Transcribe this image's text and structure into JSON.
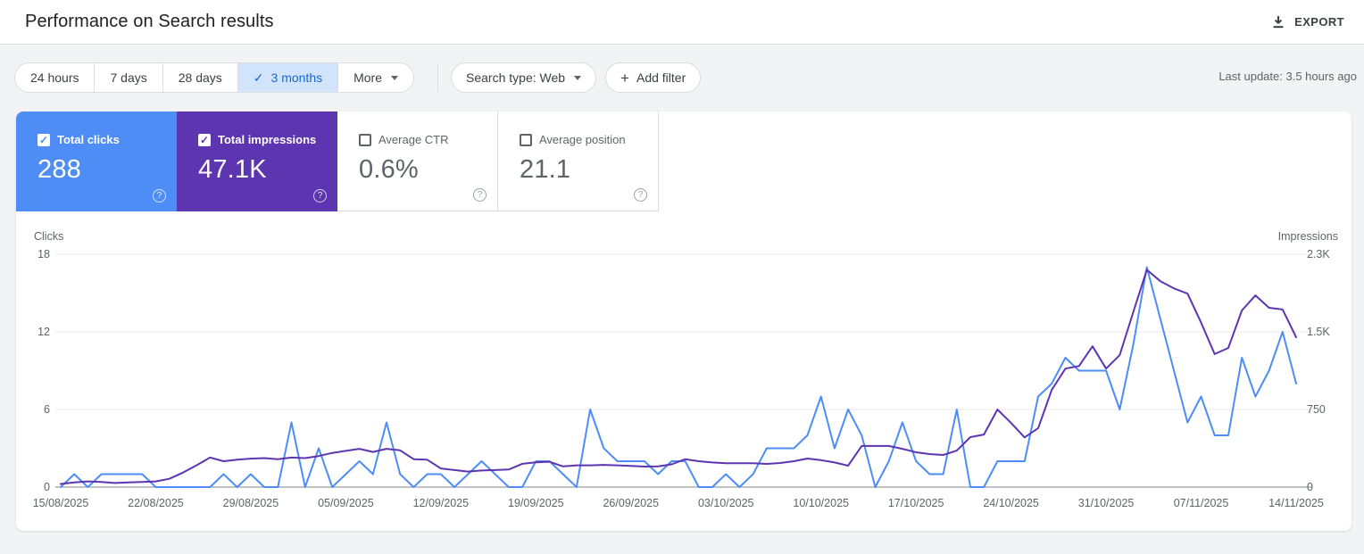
{
  "header": {
    "title": "Performance on Search results",
    "export_label": "EXPORT"
  },
  "filters": {
    "date_ranges": [
      {
        "label": "24 hours",
        "selected": false
      },
      {
        "label": "7 days",
        "selected": false
      },
      {
        "label": "28 days",
        "selected": false
      },
      {
        "label": "3 months",
        "selected": true
      },
      {
        "label": "More",
        "selected": false
      }
    ],
    "search_type_label": "Search type: Web",
    "add_filter_label": "Add filter",
    "last_update": "Last update: 3.5 hours ago"
  },
  "metric_cards": [
    {
      "label": "Total clicks",
      "value": "288",
      "checked": true,
      "color": "#4e8df6"
    },
    {
      "label": "Total impressions",
      "value": "47.1K",
      "checked": true,
      "color": "#5e35b1"
    },
    {
      "label": "Average CTR",
      "value": "0.6%",
      "checked": false,
      "color": ""
    },
    {
      "label": "Average position",
      "value": "21.1",
      "checked": false,
      "color": ""
    }
  ],
  "chart_data": {
    "type": "line",
    "grid": true,
    "legend_position": "none",
    "left_axis": {
      "title": "Clicks",
      "ticks": [
        "0",
        "6",
        "12",
        "18"
      ],
      "max": 18
    },
    "right_axis": {
      "title": "Impressions",
      "ticks": [
        "0",
        "750",
        "1.5K",
        "2.3K"
      ],
      "max": 2250
    },
    "x_tick_labels": [
      "15/08/2025",
      "22/08/2025",
      "29/08/2025",
      "05/09/2025",
      "12/09/2025",
      "19/09/2025",
      "26/09/2025",
      "03/10/2025",
      "10/10/2025",
      "17/10/2025",
      "24/10/2025",
      "31/10/2025",
      "07/11/2025",
      "14/11/2025"
    ],
    "x_tick_every_n_points": 7,
    "series": [
      {
        "name": "Total clicks",
        "axis": "left",
        "color": "#4e8df6",
        "values": [
          0,
          1,
          0,
          1,
          1,
          1,
          1,
          0,
          0,
          0,
          0,
          0,
          1,
          0,
          1,
          0,
          0,
          5,
          0,
          3,
          0,
          1,
          2,
          1,
          5,
          1,
          0,
          1,
          1,
          0,
          1,
          2,
          1,
          0,
          0,
          2,
          2,
          1,
          0,
          6,
          3,
          2,
          2,
          2,
          1,
          2,
          2,
          0,
          0,
          1,
          0,
          1,
          3,
          3,
          3,
          4,
          7,
          3,
          6,
          4,
          0,
          2,
          5,
          2,
          1,
          1,
          6,
          0,
          0,
          2,
          2,
          2,
          7,
          8,
          10,
          9,
          9,
          9,
          6,
          11,
          17,
          13,
          9,
          5,
          7,
          4,
          4,
          10,
          7,
          9,
          12,
          8
        ]
      },
      {
        "name": "Total impressions",
        "axis": "right",
        "color": "#5e35b1",
        "values": [
          30,
          45,
          55,
          50,
          40,
          45,
          50,
          55,
          80,
          140,
          210,
          285,
          250,
          265,
          275,
          280,
          270,
          285,
          280,
          300,
          330,
          350,
          370,
          340,
          370,
          355,
          270,
          265,
          180,
          165,
          150,
          160,
          165,
          170,
          225,
          240,
          245,
          200,
          210,
          210,
          215,
          210,
          205,
          198,
          200,
          220,
          270,
          250,
          238,
          230,
          230,
          230,
          224,
          233,
          250,
          276,
          260,
          238,
          207,
          397,
          397,
          397,
          370,
          336,
          319,
          310,
          353,
          483,
          508,
          750,
          620,
          480,
          570,
          940,
          1145,
          1170,
          1360,
          1145,
          1275,
          1690,
          2100,
          1990,
          1920,
          1870,
          1590,
          1285,
          1345,
          1707,
          1853,
          1733,
          1716,
          1448
        ]
      }
    ]
  }
}
